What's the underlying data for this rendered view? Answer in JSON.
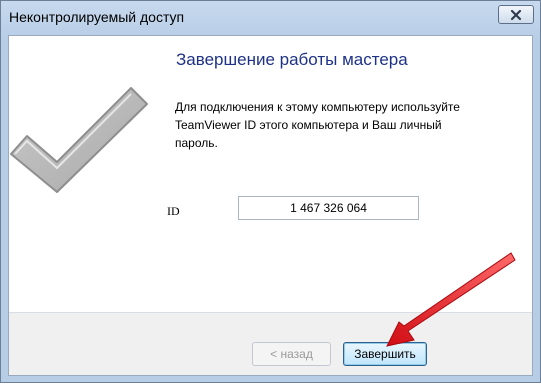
{
  "window": {
    "title": "Неконтролируемый доступ",
    "close_icon": "close-icon"
  },
  "content": {
    "heading": "Завершение работы мастера",
    "description": "Для подключения к этому компьютеру используйте TeamViewer ID этого компьютера и Ваш личный пароль.",
    "check_icon": "checkmark-icon"
  },
  "id_field": {
    "label": "ID",
    "value": "1 467 326 064"
  },
  "buttons": {
    "back": "< назад",
    "finish": "Завершить"
  },
  "annotation": {
    "arrow_color": "#e8141b"
  }
}
